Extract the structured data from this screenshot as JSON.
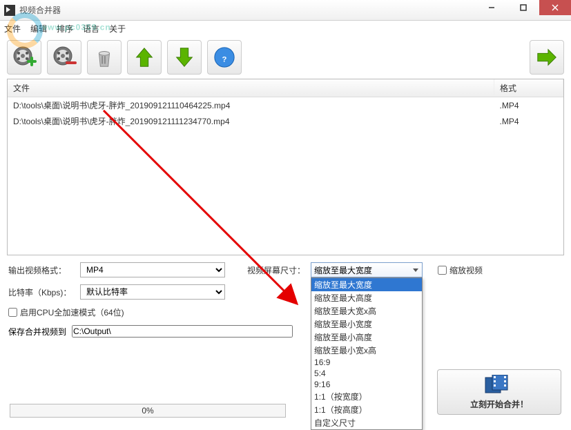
{
  "window": {
    "title": "视频合并器"
  },
  "watermark_text": "www.pc0359.cn",
  "menu": {
    "file": "文件",
    "edit": "编辑",
    "sort": "排序",
    "language": "语言",
    "about": "关于"
  },
  "toolbar": {
    "add": "add-video",
    "remove": "remove-video",
    "clear": "clear-list",
    "up": "move-up",
    "down": "move-down",
    "help": "help",
    "next": "next"
  },
  "table": {
    "col_file": "文件",
    "col_format": "格式",
    "rows": [
      {
        "file": "D:\\tools\\桌面\\说明书\\虎牙-胖炸_201909121110464225.mp4",
        "format": ".MP4"
      },
      {
        "file": "D:\\tools\\桌面\\说明书\\虎牙-胖炸_201909121111234770.mp4",
        "format": ".MP4"
      }
    ]
  },
  "settings": {
    "output_format_label": "输出视频格式：",
    "output_format_value": "MP4",
    "screen_size_label": "视频屏幕尺寸：",
    "screen_size_value": "缩放至最大宽度",
    "scale_video_label": "缩放视频",
    "bitrate_label": "比特率（Kbps)：",
    "bitrate_value": "默认比特率",
    "cpu_accel_label": "启用CPU全加速模式（64位)",
    "save_to_label": "保存合并视频到",
    "save_to_path": "C:\\Output\\",
    "screen_options": [
      "缩放至最大宽度",
      "缩放至最大高度",
      "缩放至最大宽x高",
      "缩放至最小宽度",
      "缩放至最小高度",
      "缩放至最小宽x高",
      "16:9",
      "5:4",
      "9:16",
      "1:1（按宽度）",
      "1:1（按高度）",
      "自定义尺寸"
    ]
  },
  "progress": {
    "percent": "0%"
  },
  "start_button": "立刻开始合并！",
  "colors": {
    "accent": "#2f77d1",
    "close": "#c75050",
    "green": "#5bb400",
    "orange": "#f39c12"
  }
}
